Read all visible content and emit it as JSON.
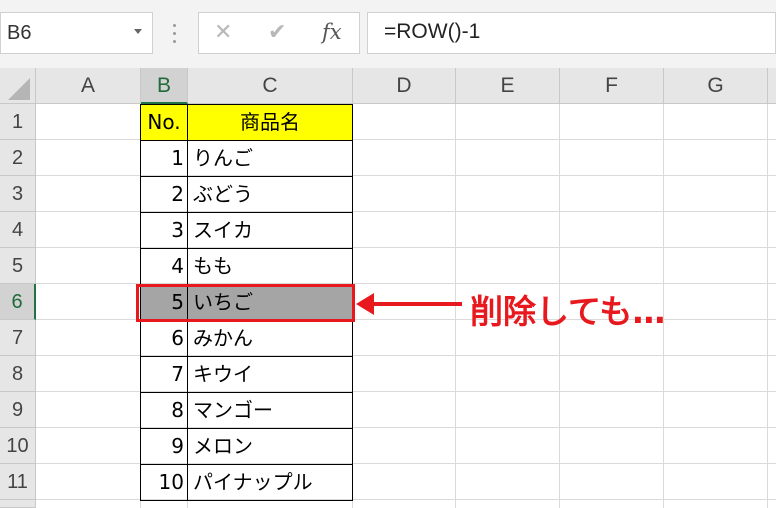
{
  "name_box": {
    "value": "B6"
  },
  "formula_bar": {
    "cancel_glyph": "✕",
    "enter_glyph": "✔",
    "fx_label": "fx",
    "formula": "=ROW()-1"
  },
  "columns": [
    "A",
    "B",
    "C",
    "D",
    "E",
    "F",
    "G"
  ],
  "selected_column": "B",
  "rows": [
    "1",
    "2",
    "3",
    "4",
    "5",
    "6",
    "7",
    "8",
    "9",
    "10",
    "11"
  ],
  "selected_row": "6",
  "table": {
    "header": {
      "no": "No.",
      "name": "商品名"
    },
    "items": [
      {
        "no": "1",
        "name": "りんご"
      },
      {
        "no": "2",
        "name": "ぶどう"
      },
      {
        "no": "3",
        "name": "スイカ"
      },
      {
        "no": "4",
        "name": "もも"
      },
      {
        "no": "5",
        "name": "いちご"
      },
      {
        "no": "6",
        "name": "みかん"
      },
      {
        "no": "7",
        "name": "キウイ"
      },
      {
        "no": "8",
        "name": "マンゴー"
      },
      {
        "no": "9",
        "name": "メロン"
      },
      {
        "no": "10",
        "name": "パイナップル"
      }
    ]
  },
  "annotation": {
    "text": "削除しても…",
    "color": "#e8191e"
  },
  "colors": {
    "header_fill": "#ffff00",
    "highlight_fill": "#a5a5a5",
    "accent": "#217346"
  }
}
